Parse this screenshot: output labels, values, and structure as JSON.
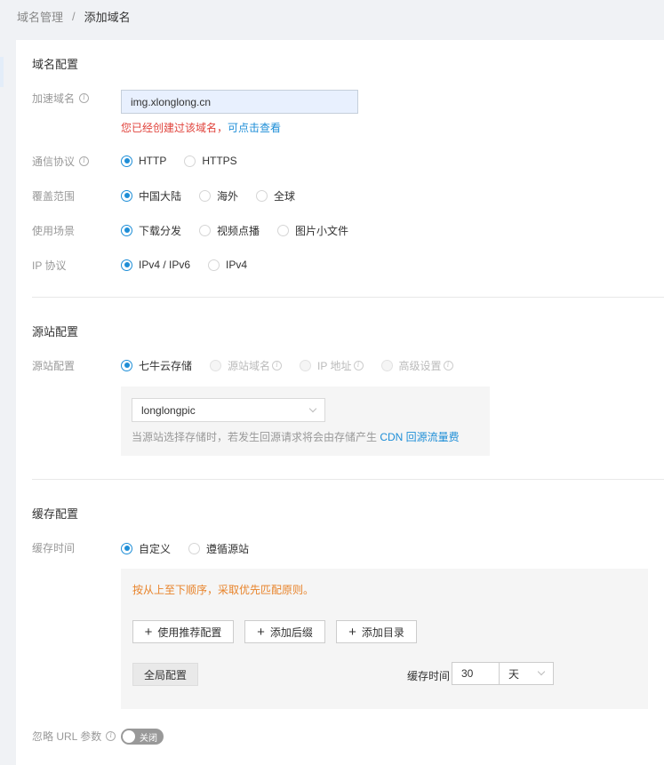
{
  "breadcrumb": {
    "parent": "域名管理",
    "separator": "/",
    "current": "添加域名"
  },
  "domain_section": {
    "title": "域名配置",
    "domain_label": "加速域名",
    "domain_value": "img.xlonglong.cn",
    "error_text": "您已经创建过该域名，",
    "error_link": "可点击查看",
    "protocol": {
      "label": "通信协议",
      "options": [
        "HTTP",
        "HTTPS"
      ],
      "selected": "HTTP"
    },
    "coverage": {
      "label": "覆盖范围",
      "options": [
        "中国大陆",
        "海外",
        "全球"
      ],
      "selected": "中国大陆"
    },
    "scenario": {
      "label": "使用场景",
      "options": [
        "下载分发",
        "视频点播",
        "图片小文件"
      ],
      "selected": "下载分发"
    },
    "ip_protocol": {
      "label": "IP 协议",
      "options": [
        "IPv4 / IPv6",
        "IPv4"
      ],
      "selected": "IPv4 / IPv6"
    }
  },
  "origin_section": {
    "title": "源站配置",
    "label": "源站配置",
    "options": [
      "七牛云存储",
      "源站域名",
      "IP 地址",
      "高级设置"
    ],
    "selected": "七牛云存储",
    "bucket_value": "longlongpic",
    "hint_text": "当源站选择存储时，若发生回源请求将会由存储产生 ",
    "hint_link": "CDN 回源流量费"
  },
  "cache_section": {
    "title": "缓存配置",
    "label": "缓存时间",
    "options": [
      "自定义",
      "遵循源站"
    ],
    "selected": "自定义",
    "tip": "按从上至下顺序，采取优先匹配原则。",
    "btn_recommend": "使用推荐配置",
    "btn_suffix": "添加后缀",
    "btn_dir": "添加目录",
    "btn_global": "全局配置",
    "time_label": "缓存时间",
    "time_value": "30",
    "time_unit": "天"
  },
  "ignore_url": {
    "label": "忽略 URL 参数",
    "toggle_text": "关闭",
    "enabled": false
  },
  "colors": {
    "accent": "#1e8ed7",
    "error": "#e0433c",
    "warning": "#e8832a"
  }
}
